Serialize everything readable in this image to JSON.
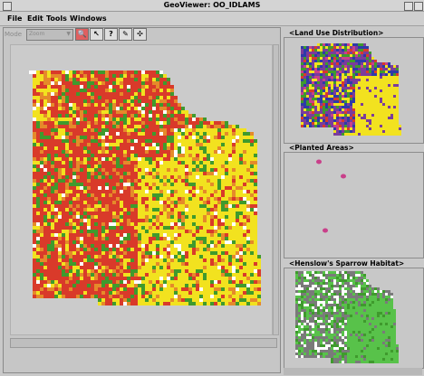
{
  "window": {
    "title": "GeoViewer: OO_IDLAMS"
  },
  "menu": [
    "File",
    "Edit",
    "Tools",
    "Windows"
  ],
  "toolbar": {
    "mode_label": "Mode",
    "mode_value": "Zoom",
    "tool_icons": [
      "zoom-icon",
      "pointer-icon",
      "help-icon",
      "measure-icon",
      "settings-icon"
    ]
  },
  "panels": {
    "land_use": {
      "title": "<Land Use Distribution>"
    },
    "planted": {
      "title": "<Planted Areas>"
    },
    "sparrow": {
      "title": "<Henslow's Sparrow Habitat>"
    }
  },
  "colors": {
    "red": "#d93a2a",
    "yellow": "#f2e21f",
    "green": "#3f9a2d",
    "orange": "#e58a2a",
    "gray": "#7a7a7a",
    "light_gray": "#bdbdbd",
    "lightgreen": "#58c24a",
    "purple": "#7a3c9c",
    "blue": "#2e3aa8",
    "magenta": "#c9408a"
  }
}
